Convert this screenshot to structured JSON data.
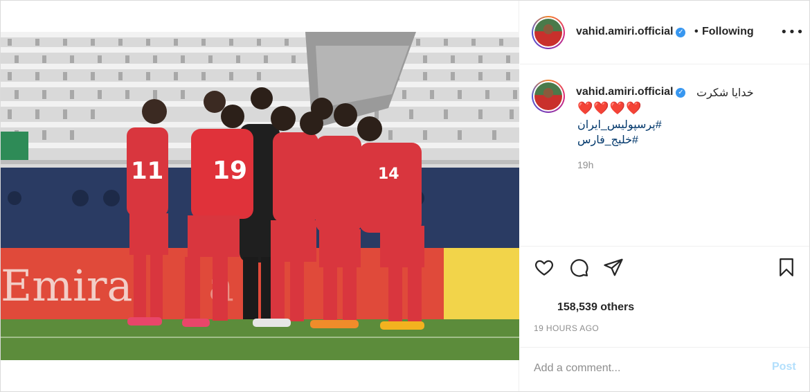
{
  "post": {
    "media_description_alt": "",
    "author": {
      "username": "vahid.amiri.official",
      "verified_icon": "verified-badge-icon",
      "follow_state": "Following",
      "separator": "•"
    },
    "caption": {
      "username": "vahid.amiri.official",
      "text": "خدایا شکرت",
      "hearts": "❤️❤️❤️❤️",
      "hashtags": [
        "#پرسپولیس_ایران",
        "#خلیج_فارس"
      ],
      "time": "19h"
    },
    "actions": {
      "like_icon": "heart-icon",
      "comment_icon": "comment-icon",
      "share_icon": "paper-plane-icon",
      "save_icon": "bookmark-icon"
    },
    "likes_text": "158,539 others",
    "timestamp": "19 HOURS AGO",
    "comment_box": {
      "placeholder": "Add a comment...",
      "post_label": "Post"
    },
    "more_label": "•••",
    "colors": {
      "link": "#00376b",
      "secondary": "#8e8e8e",
      "post_disabled": "#b2dffc",
      "verified": "#3897f0"
    }
  }
}
